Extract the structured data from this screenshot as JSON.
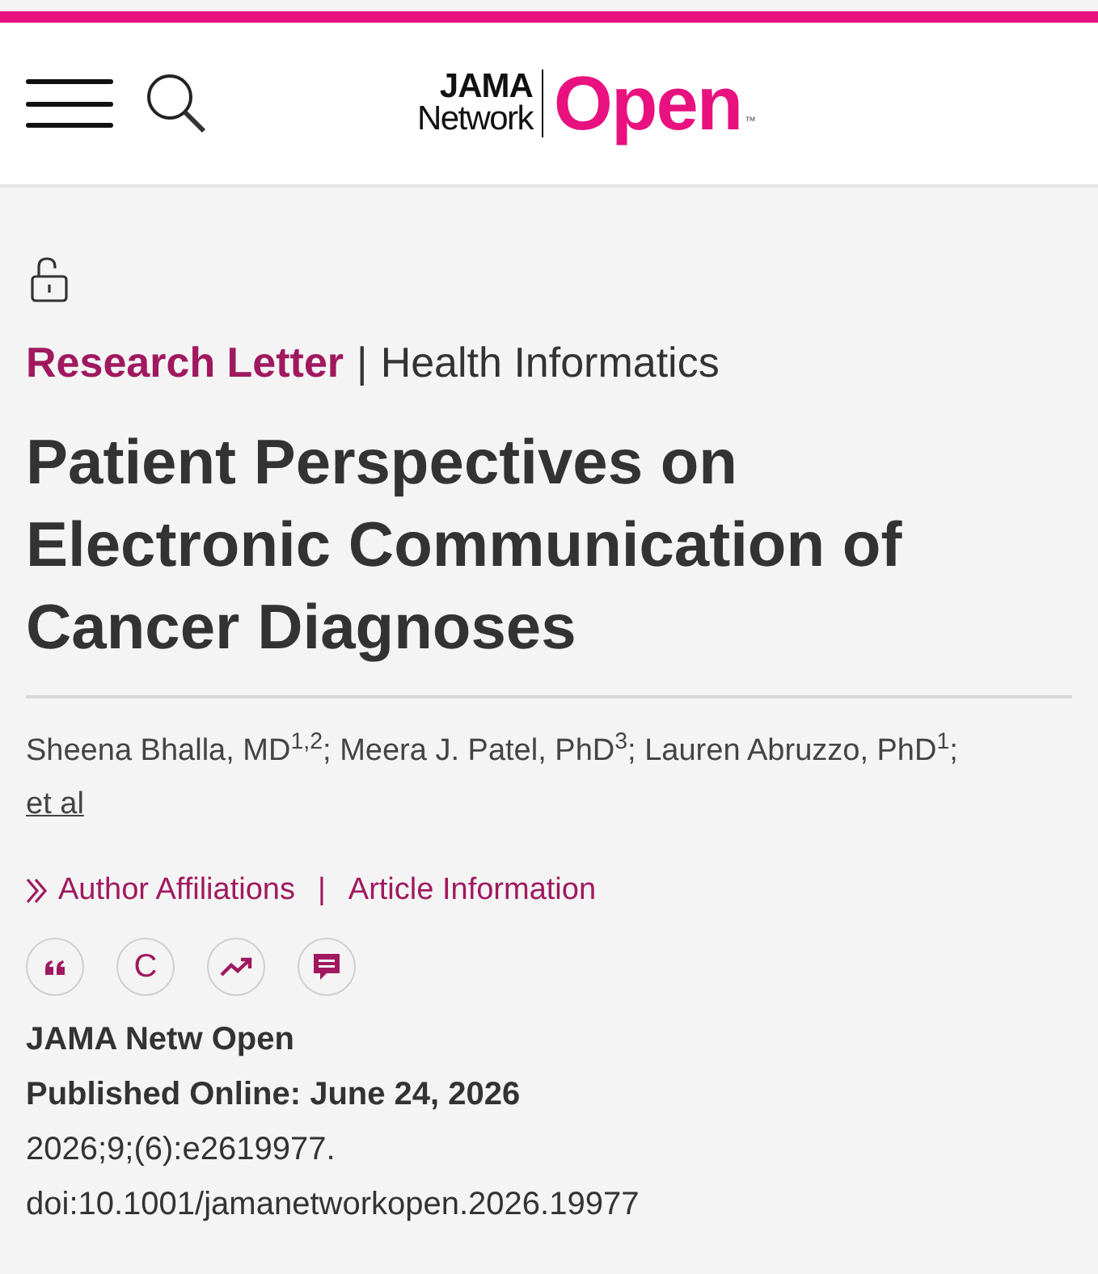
{
  "header": {
    "logo": {
      "line_1": "JAMA",
      "line_2": "Network",
      "wordmark": "Open",
      "trademark": "™"
    }
  },
  "article": {
    "article_type": "Research Letter",
    "separator": "|",
    "category": "Health Informatics",
    "title": "Patient Perspectives on Electronic Communication of Cancer Diagnoses",
    "authors": "Sheena Bhalla, MD$^{1,2}$; Meera J. Patel, PhD$^{3}$; Lauren Abruzzo, PhD$^{1}$;",
    "authors_link": "et al",
    "links": [
      {
        "label": "Author Affiliations",
        "kind": "expand"
      },
      {
        "label": "|",
        "kind": "separator"
      },
      {
        "label": "Article Information",
        "kind": "link"
      }
    ],
    "tools": [
      {
        "kind": "quote"
      },
      {
        "kind": "letter",
        "label": "C"
      },
      {
        "kind": "trend"
      },
      {
        "kind": "comment"
      }
    ],
    "citation": {
      "journal": "JAMA Netw Open",
      "published": "Published Online: June 24, 2026",
      "volume": "2026;9;(6):e2619977.",
      "doi": "doi:10.1001/jamanetworkopen.2026.19977"
    }
  }
}
